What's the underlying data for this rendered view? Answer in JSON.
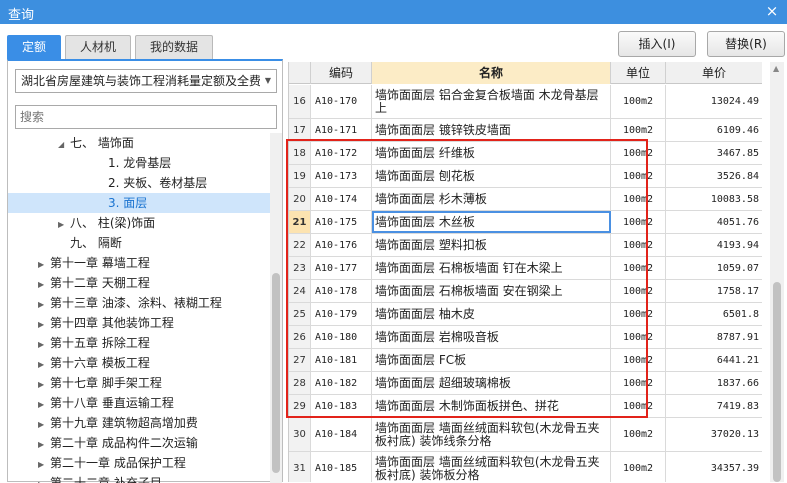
{
  "window": {
    "title": "查询",
    "close_glyph": "×"
  },
  "tabs": [
    {
      "label": "定额"
    },
    {
      "label": "人材机"
    },
    {
      "label": "我的数据"
    }
  ],
  "actions": {
    "insert": "插入(I)",
    "replace": "替换(R)"
  },
  "library": {
    "selected": "湖北省房屋建筑与装饰工程消耗量定额及全费月"
  },
  "search": {
    "placeholder": "搜索"
  },
  "tree": [
    {
      "label": "七、 墙饰面",
      "toggle": "◢",
      "indent": 1
    },
    {
      "label": "1. 龙骨基层",
      "toggle": "",
      "indent": 2
    },
    {
      "label": "2. 夹板、卷材基层",
      "toggle": "",
      "indent": 2
    },
    {
      "label": "3. 面层",
      "toggle": "",
      "indent": 2,
      "selected": true
    },
    {
      "label": "八、 柱(梁)饰面",
      "toggle": "▶",
      "indent": 1
    },
    {
      "label": "九、 隔断",
      "toggle": "",
      "indent": 1
    },
    {
      "label": "第十一章 幕墙工程",
      "toggle": "▶",
      "indent": 0
    },
    {
      "label": "第十二章 天棚工程",
      "toggle": "▶",
      "indent": 0
    },
    {
      "label": "第十三章 油漆、涂料、裱糊工程",
      "toggle": "▶",
      "indent": 0
    },
    {
      "label": "第十四章 其他装饰工程",
      "toggle": "▶",
      "indent": 0
    },
    {
      "label": "第十五章 拆除工程",
      "toggle": "▶",
      "indent": 0
    },
    {
      "label": "第十六章 模板工程",
      "toggle": "▶",
      "indent": 0
    },
    {
      "label": "第十七章 脚手架工程",
      "toggle": "▶",
      "indent": 0
    },
    {
      "label": "第十八章 垂直运输工程",
      "toggle": "▶",
      "indent": 0
    },
    {
      "label": "第十九章 建筑物超高增加费",
      "toggle": "▶",
      "indent": 0
    },
    {
      "label": "第二十章 成品构件二次运输",
      "toggle": "▶",
      "indent": 0
    },
    {
      "label": "第二十一章 成品保护工程",
      "toggle": "▶",
      "indent": 0
    },
    {
      "label": "第二十二章 补充子目",
      "toggle": "▶",
      "indent": 0
    }
  ],
  "grid": {
    "headers": {
      "code": "编码",
      "name": "名称",
      "unit": "单位",
      "price": "单价"
    },
    "rows": [
      {
        "idx": "16",
        "code": "A10-170",
        "name": "墙饰面面层 铝合金复合板墙面 木龙骨基层上",
        "unit": "100m2",
        "price": "13024.49"
      },
      {
        "idx": "17",
        "code": "A10-171",
        "name": "墙饰面面层 镀锌铁皮墙面",
        "unit": "100m2",
        "price": "6109.46"
      },
      {
        "idx": "18",
        "code": "A10-172",
        "name": "墙饰面面层 纤维板",
        "unit": "100m2",
        "price": "3467.85"
      },
      {
        "idx": "19",
        "code": "A10-173",
        "name": "墙饰面面层 刨花板",
        "unit": "100m2",
        "price": "3526.84"
      },
      {
        "idx": "20",
        "code": "A10-174",
        "name": "墙饰面面层 杉木薄板",
        "unit": "100m2",
        "price": "10083.58"
      },
      {
        "idx": "21",
        "code": "A10-175",
        "name": "墙饰面面层 木丝板",
        "unit": "100m2",
        "price": "4051.76",
        "current": true
      },
      {
        "idx": "22",
        "code": "A10-176",
        "name": "墙饰面面层 塑料扣板",
        "unit": "100m2",
        "price": "4193.94"
      },
      {
        "idx": "23",
        "code": "A10-177",
        "name": "墙饰面面层 石棉板墙面 钉在木梁上",
        "unit": "100m2",
        "price": "1059.07"
      },
      {
        "idx": "24",
        "code": "A10-178",
        "name": "墙饰面面层 石棉板墙面 安在钢梁上",
        "unit": "100m2",
        "price": "1758.17"
      },
      {
        "idx": "25",
        "code": "A10-179",
        "name": "墙饰面面层 柚木皮",
        "unit": "100m2",
        "price": "6501.8"
      },
      {
        "idx": "26",
        "code": "A10-180",
        "name": "墙饰面面层 岩棉吸音板",
        "unit": "100m2",
        "price": "8787.91"
      },
      {
        "idx": "27",
        "code": "A10-181",
        "name": "墙饰面面层 FC板",
        "unit": "100m2",
        "price": "6441.21"
      },
      {
        "idx": "28",
        "code": "A10-182",
        "name": "墙饰面面层 超细玻璃棉板",
        "unit": "100m2",
        "price": "1837.66"
      },
      {
        "idx": "29",
        "code": "A10-183",
        "name": "墙饰面面层 木制饰面板拼色、拼花",
        "unit": "100m2",
        "price": "7419.83"
      },
      {
        "idx": "30",
        "code": "A10-184",
        "name": "墙饰面面层 墙面丝绒面料软包(木龙骨五夹板衬底) 装饰线条分格",
        "unit": "100m2",
        "price": "37020.13"
      },
      {
        "idx": "31",
        "code": "A10-185",
        "name": "墙饰面面层 墙面丝绒面料软包(木龙骨五夹板衬底) 装饰板分格",
        "unit": "100m2",
        "price": "34357.39"
      }
    ]
  },
  "colors": {
    "titlebar": "#3d8fdf",
    "tab_active": "#3a8ee6",
    "highlight_box": "#e2231a",
    "header_name_bg": "#fcecc6"
  }
}
